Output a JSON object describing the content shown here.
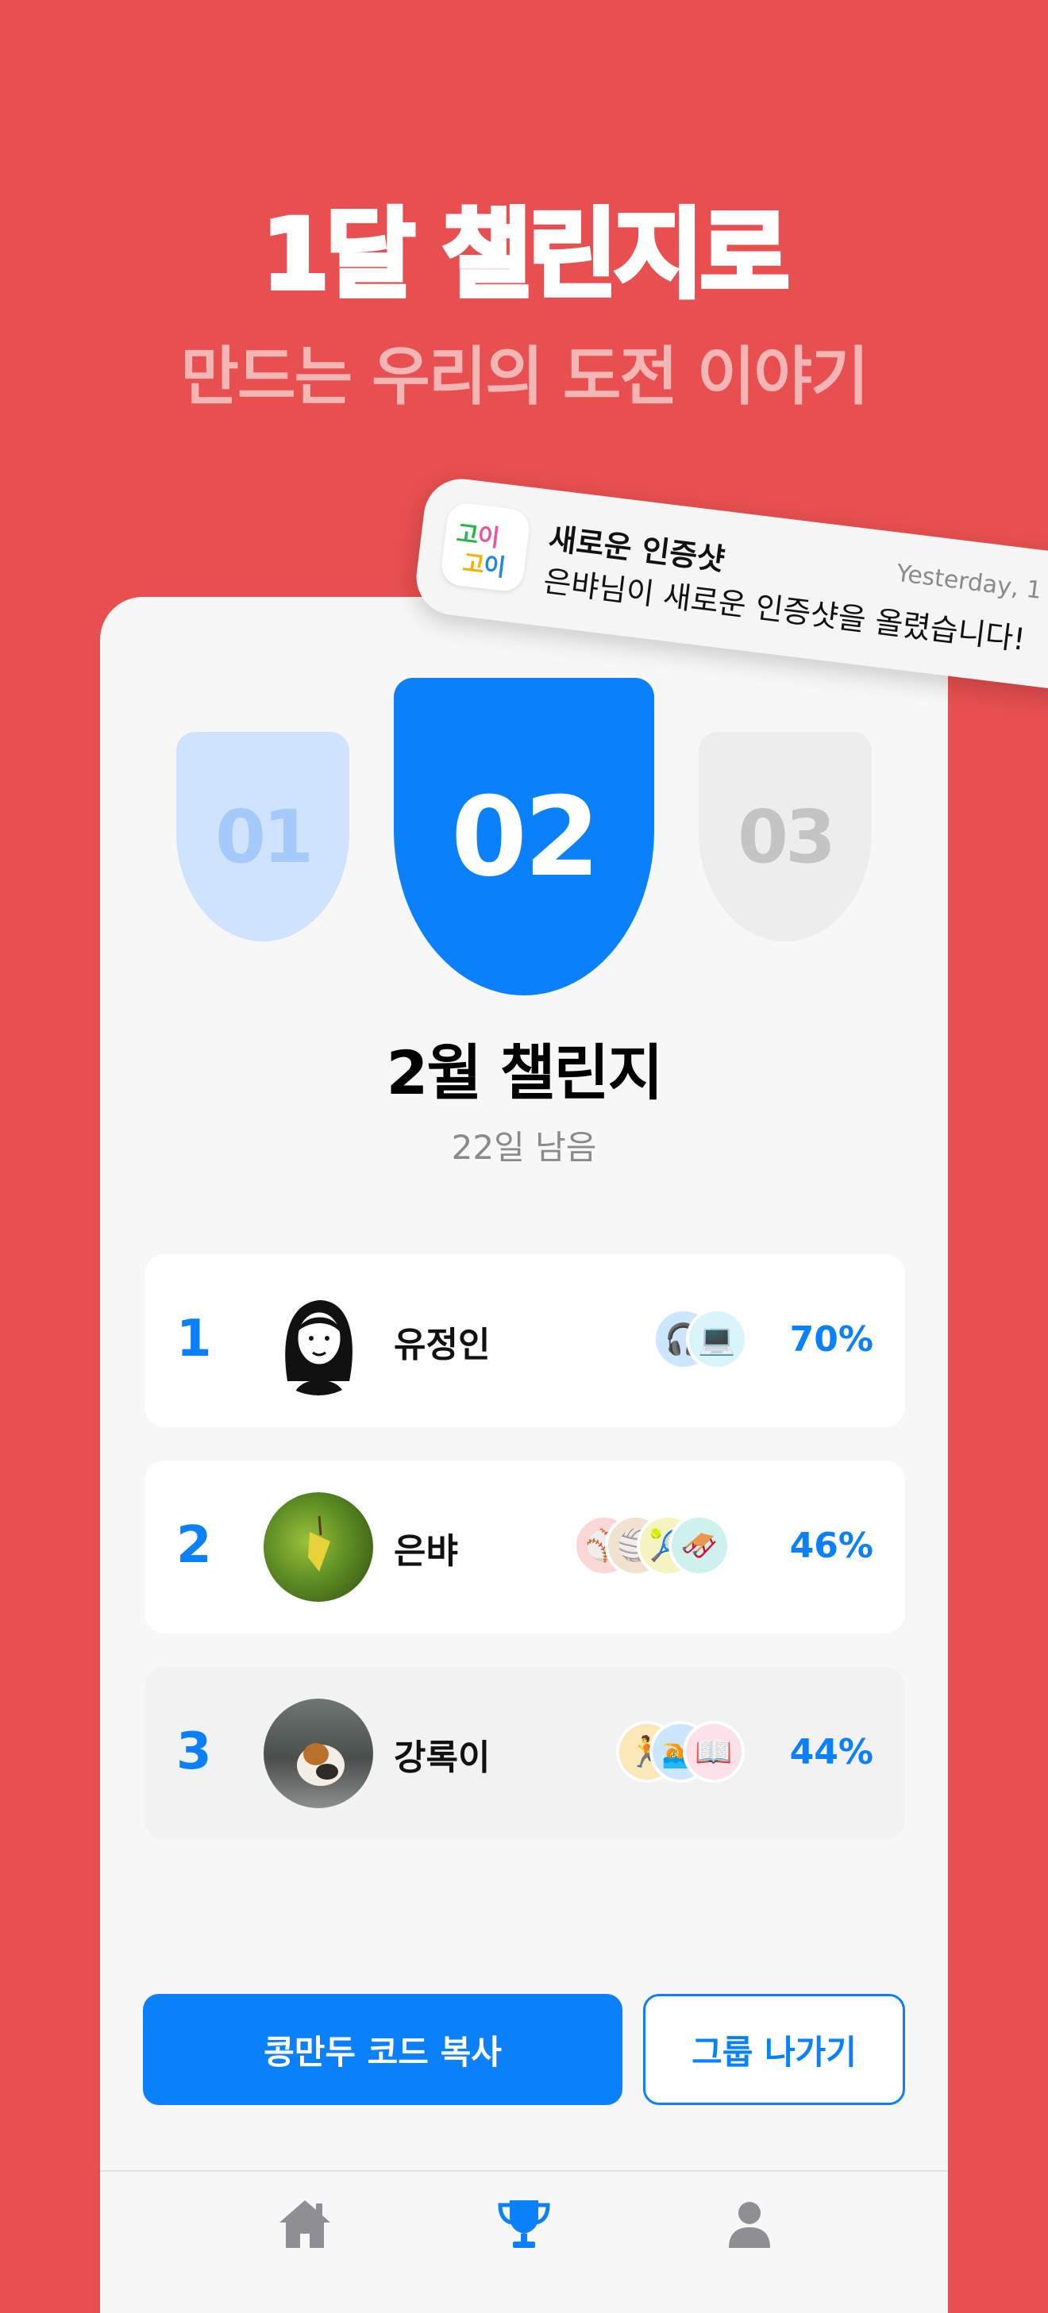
{
  "hero": {
    "headline": "1달 챌린지로",
    "subhead": "만드는 우리의 도전 이야기"
  },
  "notification": {
    "app_icon_text": "고이 고이",
    "title": "새로운 인증샷",
    "body": "은뱌님이 새로운 인증샷을 올렸습니다!",
    "time": "Yesterday, 1"
  },
  "rounds": [
    {
      "label": "01",
      "state": "previous"
    },
    {
      "label": "02",
      "state": "current"
    },
    {
      "label": "03",
      "state": "upcoming"
    }
  ],
  "challenge": {
    "title": "2월 챌린지",
    "days_left": "22일 남음"
  },
  "leaderboard": [
    {
      "rank": "1",
      "name": "유정인",
      "percent": "70%",
      "badge_icons": [
        "headphones-icon",
        "laptop-icon"
      ]
    },
    {
      "rank": "2",
      "name": "은뱌",
      "percent": "46%",
      "badge_icons": [
        "baseball-icon",
        "volleyball-icon",
        "tennis-ball-icon",
        "sled-icon"
      ]
    },
    {
      "rank": "3",
      "name": "강록이",
      "percent": "44%",
      "badge_icons": [
        "runner-icon",
        "swimmer-icon",
        "book-icon"
      ]
    }
  ],
  "actions": {
    "copy_code": "콩만두 코드 복사",
    "leave_group": "그룹 나가기"
  },
  "tabbar": {
    "items": [
      "home-icon",
      "trophy-icon",
      "person-icon"
    ],
    "active": "trophy-icon"
  },
  "colors": {
    "background": "#E84F50",
    "accent": "#0A80FB",
    "panel": "#F7F7F7"
  }
}
